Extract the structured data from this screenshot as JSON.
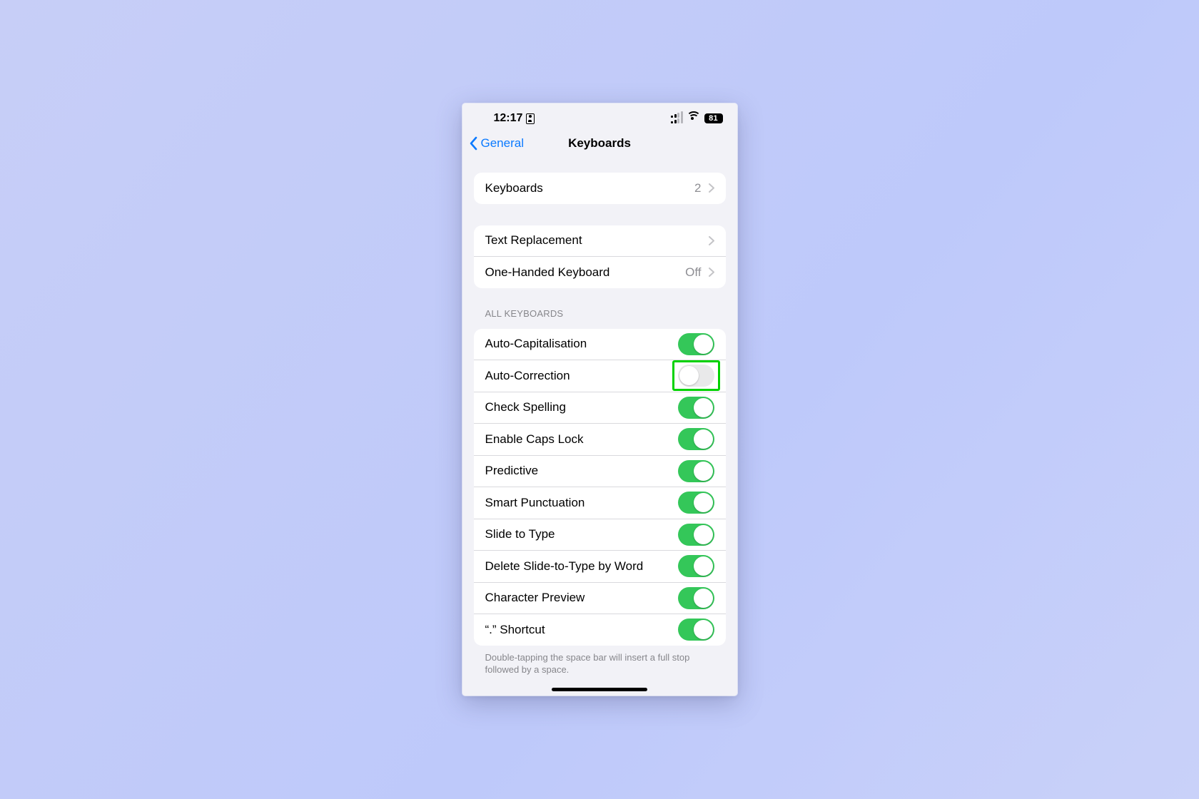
{
  "status": {
    "time": "12:17",
    "battery": "81"
  },
  "nav": {
    "back": "General",
    "title": "Keyboards"
  },
  "rows": {
    "keyboards": {
      "label": "Keyboards",
      "value": "2"
    },
    "text_repl": {
      "label": "Text Replacement"
    },
    "one_handed": {
      "label": "One-Handed Keyboard",
      "value": "Off"
    }
  },
  "section_all": "ALL KEYBOARDS",
  "toggles": [
    {
      "label": "Auto-Capitalisation",
      "on": true
    },
    {
      "label": "Auto-Correction",
      "on": false
    },
    {
      "label": "Check Spelling",
      "on": true
    },
    {
      "label": "Enable Caps Lock",
      "on": true
    },
    {
      "label": "Predictive",
      "on": true
    },
    {
      "label": "Smart Punctuation",
      "on": true
    },
    {
      "label": "Slide to Type",
      "on": true
    },
    {
      "label": "Delete Slide-to-Type by Word",
      "on": true
    },
    {
      "label": "Character Preview",
      "on": true
    },
    {
      "label": "“.” Shortcut",
      "on": true
    }
  ],
  "footer": "Double-tapping the space bar will insert a full stop followed by a space.",
  "highlight_toggle_index": 1
}
